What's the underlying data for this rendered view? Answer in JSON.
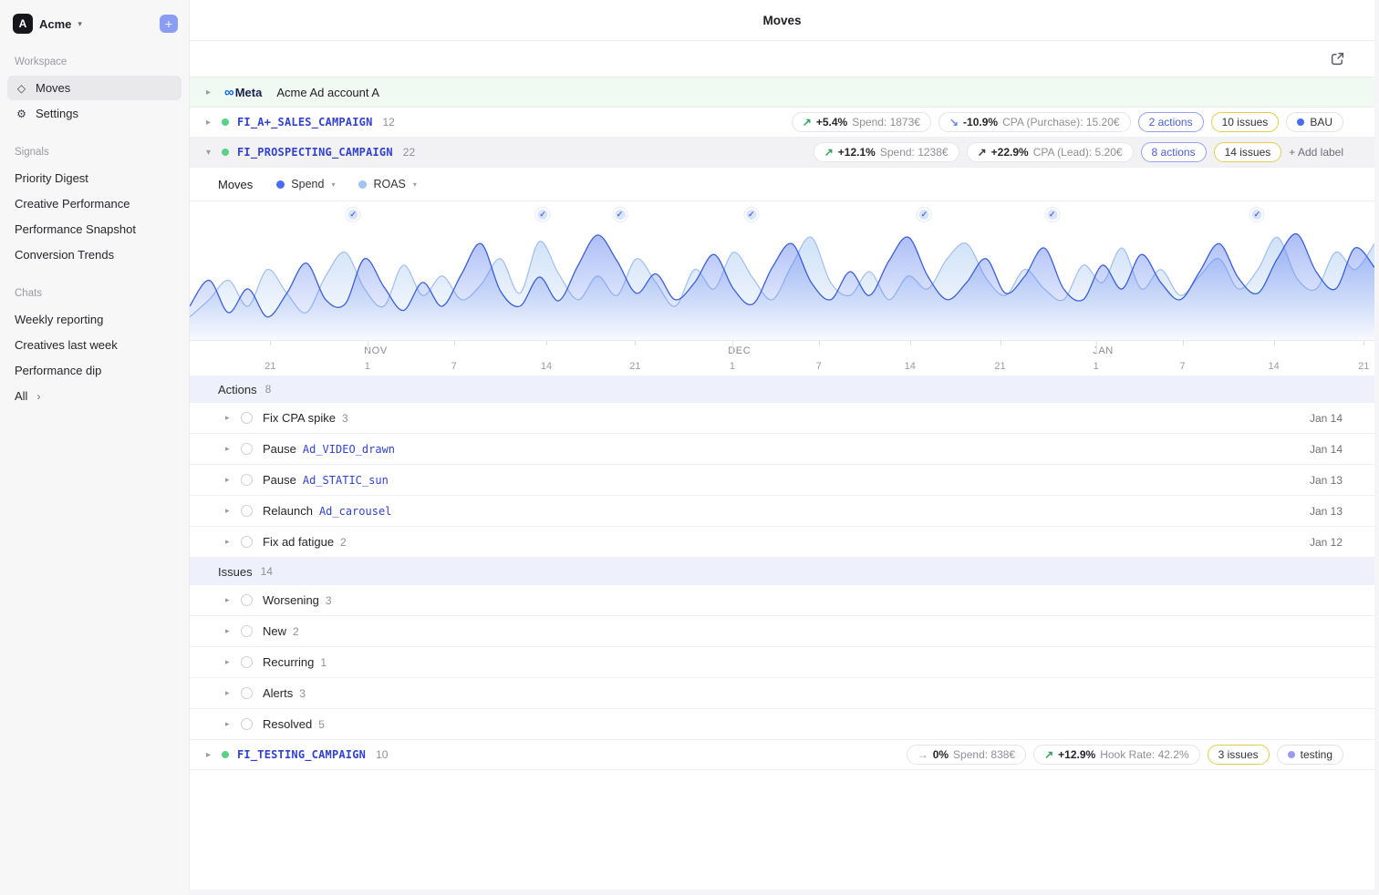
{
  "icons": {
    "chevron_down": "▾",
    "chevron_right": "▸",
    "chevron_small": "›",
    "plus": "+",
    "gear": "⚙",
    "diamond": "◇",
    "check": "✓",
    "infinity": "∞",
    "arrow_up_right": "↗",
    "arrow_down_right": "↘",
    "arrow_right": "→"
  },
  "sidebar": {
    "logo_letter": "A",
    "workspace": "Acme",
    "add_label": "+",
    "workspace_section": "Workspace",
    "signals_section": "Signals",
    "chats_section": "Chats",
    "items": {
      "moves": "Moves",
      "settings": "Settings",
      "priority_digest": "Priority Digest",
      "creative_performance": "Creative Performance",
      "performance_snapshot": "Performance Snapshot",
      "conversion_trends": "Conversion Trends",
      "weekly_reporting": "Weekly reporting",
      "creatives_last_week": "Creatives last week",
      "performance_dip": "Performance dip",
      "all": "All"
    }
  },
  "header": {
    "title": "Moves"
  },
  "account": {
    "provider": "Meta",
    "name": "Acme Ad account A"
  },
  "campaigns": [
    {
      "name": "FI_A+_SALES_CAMPAIGN",
      "count": "12",
      "metrics": [
        {
          "arrow": "↗",
          "pct": "+5.4%",
          "label": "Spend: 1873€"
        },
        {
          "arrow": "↘",
          "pct": "-10.9%",
          "label": "CPA (Purchase): 15.20€"
        }
      ],
      "actions_pill": "2 actions",
      "issues_pill": "10 issues",
      "tag": {
        "text": "BAU"
      }
    },
    {
      "name": "FI_PROSPECTING_CAMPAIGN",
      "count": "22",
      "metrics": [
        {
          "arrow": "↗",
          "pct": "+12.1%",
          "label": "Spend: 1238€"
        },
        {
          "arrow": "↗",
          "pct": "+22.9%",
          "label": "CPA (Lead): 5.20€"
        }
      ],
      "actions_pill": "8 actions",
      "issues_pill": "14 issues",
      "add_label": "+ Add label"
    },
    {
      "name": "FI_TESTING_CAMPAIGN",
      "count": "10",
      "metrics": [
        {
          "arrow": "→",
          "pct": "0%",
          "label": "Spend: 838€"
        },
        {
          "arrow": "↗",
          "pct": "+12.9%",
          "label": "Hook Rate: 42.2%"
        }
      ],
      "issues_pill": "3 issues",
      "tag": {
        "text": "testing"
      }
    }
  ],
  "chart": {
    "type": "area",
    "controls": {
      "title": "Moves",
      "legend": [
        {
          "label": "Spend"
        },
        {
          "label": "ROAS"
        }
      ]
    },
    "colors": {
      "spend": "#3a5fd9",
      "roas": "#9fbef0"
    },
    "markers": [
      0.138,
      0.298,
      0.363,
      0.474,
      0.62,
      0.728,
      0.901
    ],
    "months": [
      {
        "label": "NOV",
        "x": 0.157
      },
      {
        "label": "DEC",
        "x": 0.464
      },
      {
        "label": "JAN",
        "x": 0.771
      }
    ],
    "ticks": [
      {
        "label": "21",
        "x": 0.068
      },
      {
        "label": "1",
        "x": 0.15
      },
      {
        "label": "7",
        "x": 0.223
      },
      {
        "label": "14",
        "x": 0.301
      },
      {
        "label": "21",
        "x": 0.376
      },
      {
        "label": "1",
        "x": 0.458
      },
      {
        "label": "7",
        "x": 0.531
      },
      {
        "label": "14",
        "x": 0.608
      },
      {
        "label": "21",
        "x": 0.684
      },
      {
        "label": "1",
        "x": 0.765
      },
      {
        "label": "7",
        "x": 0.838
      },
      {
        "label": "14",
        "x": 0.915
      },
      {
        "label": "21",
        "x": 0.991
      }
    ],
    "series": {
      "spend": [
        28,
        52,
        22,
        44,
        18,
        40,
        68,
        34,
        30,
        72,
        46,
        24,
        50,
        28,
        58,
        86,
        42,
        28,
        55,
        33,
        66,
        94,
        70,
        40,
        58,
        34,
        50,
        76,
        44,
        30,
        64,
        86,
        50,
        34,
        60,
        38,
        70,
        92,
        56,
        34,
        50,
        72,
        40,
        56,
        82,
        44,
        34,
        66,
        44,
        76,
        50,
        34,
        60,
        86,
        54,
        40,
        72,
        95,
        60,
        44,
        82,
        64
      ],
      "roas": [
        18,
        34,
        52,
        28,
        62,
        40,
        22,
        56,
        78,
        44,
        28,
        66,
        38,
        56,
        34,
        48,
        72,
        40,
        88,
        58,
        34,
        56,
        38,
        72,
        50,
        28,
        62,
        44,
        78,
        54,
        34,
        66,
        92,
        50,
        38,
        60,
        34,
        56,
        44,
        72,
        86,
        54,
        38,
        62,
        44,
        34,
        66,
        50,
        82,
        44,
        62,
        38,
        56,
        72,
        44,
        62,
        92,
        54,
        44,
        78,
        62,
        86
      ]
    }
  },
  "actions": {
    "label": "Actions",
    "count": "8",
    "rows": [
      {
        "title": "Fix CPA spike",
        "count": "3",
        "date": "Jan 14"
      },
      {
        "title": "Pause",
        "link": "Ad_VIDEO_drawn",
        "date": "Jan 14"
      },
      {
        "title": "Pause",
        "link": "Ad_STATIC_sun",
        "date": "Jan 13"
      },
      {
        "title": "Relaunch",
        "link": "Ad_carousel",
        "date": "Jan 13"
      },
      {
        "title": "Fix ad fatigue",
        "count": "2",
        "date": "Jan 12"
      }
    ]
  },
  "issues": {
    "label": "Issues",
    "count": "14",
    "rows": [
      {
        "title": "Worsening",
        "count": "3"
      },
      {
        "title": "New",
        "count": "2"
      },
      {
        "title": "Recurring",
        "count": "1"
      },
      {
        "title": "Alerts",
        "count": "3"
      },
      {
        "title": "Resolved",
        "count": "5"
      }
    ]
  }
}
